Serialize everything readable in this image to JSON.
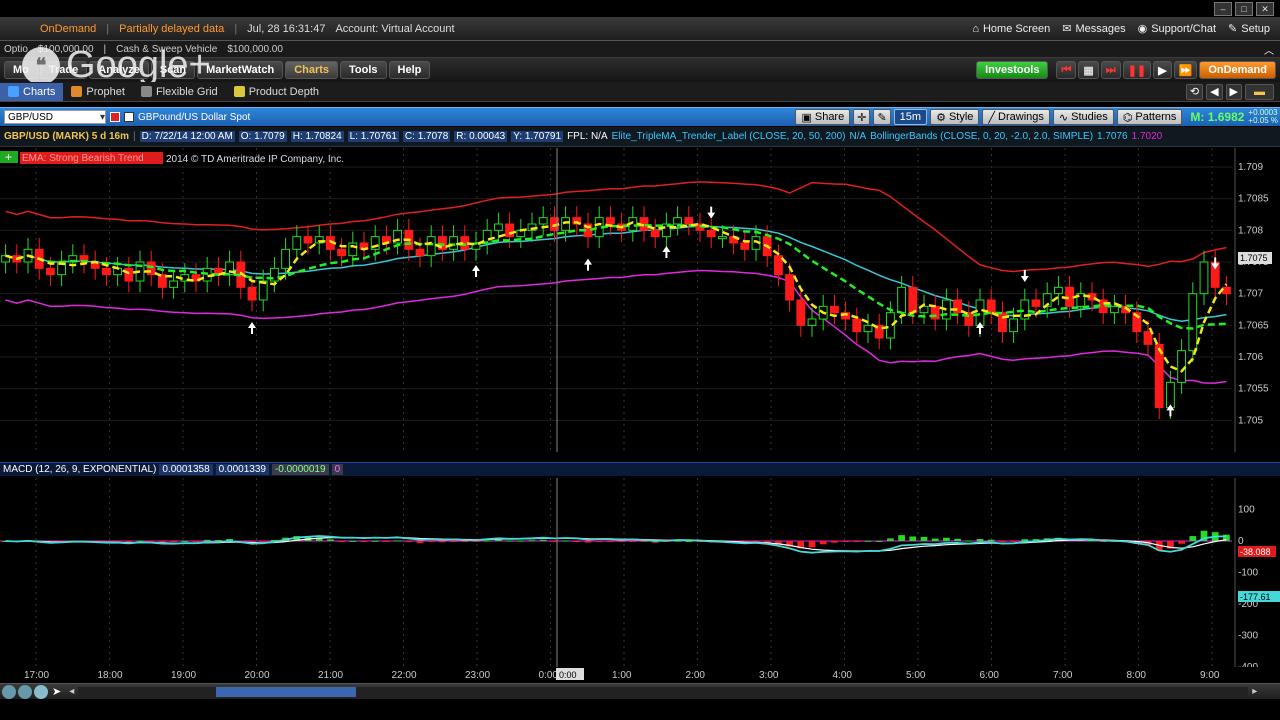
{
  "top": {
    "on_demand": "OnDemand",
    "data_status": "Partially delayed data",
    "timestamp": "Jul, 28  16:31:47",
    "account": "Account:  Virtual Account",
    "home_screen": "Home Screen",
    "messages": "Messages",
    "support": "Support/Chat",
    "setup": "Setup"
  },
  "account_bar": {
    "option": "Optio",
    "option_value": "$100,000.00",
    "cash_label": "Cash & Sweep Vehicle",
    "cash_value": "$100,000.00"
  },
  "watermark": "Google+",
  "nav": {
    "tabs": [
      "Mo",
      "Trade",
      "Analyze",
      "Scan",
      "MarketWatch",
      "Charts",
      "Tools",
      "Help"
    ],
    "active": "Charts",
    "investools": "Investools",
    "ondemand": "OnDemand"
  },
  "sub_nav": {
    "tabs": [
      "Charts",
      "Prophet",
      "Flexible Grid",
      "Product Depth"
    ]
  },
  "chart_toolbar": {
    "symbol": "GBP/USD",
    "description": "GBPound/US Dollar Spot",
    "share": "Share",
    "interval": "15m",
    "style": "Style",
    "drawings": "Drawings",
    "studies": "Studies",
    "patterns": "Patterns",
    "mark_value": "M: 1.6982",
    "change": "+0.0003",
    "change_pct": "+0.05 %"
  },
  "study_bar": {
    "symbol_info": "GBP/USD (MARK) 5 d 16m",
    "date": "D: 7/22/14 12:00 AM",
    "open": "O: 1.7079",
    "high": "H: 1.70824",
    "low": "L: 1.70761",
    "close": "C: 1.7078",
    "range": "R: 0.00043",
    "y": "Y: 1.70791",
    "fpl": "FPL: N/A",
    "study1": "Elite_TripleMA_Trender_Label (CLOSE, 20, 50, 200)",
    "study1_value": "N/A",
    "study2": "BollingerBands (CLOSE, 0, 20, -2.0, 2.0, SIMPLE)",
    "study2_value": "1.7076",
    "study2_value2": "1.7020"
  },
  "overlay": {
    "label": "EMA: Strong Bearish Trend",
    "copyright": "2014 © TD Ameritrade IP Company, Inc."
  },
  "macd": {
    "title": "MACD (12, 26, 9, EXPONENTIAL)",
    "value1": "0.0001358",
    "value2": "0.0001339",
    "value3": "-0.0000019",
    "value4": "0",
    "current_badge": "-38.088",
    "current_badge2": "-177.61"
  },
  "time_cursor": "0:00",
  "colors": {
    "bull": "#22dd22",
    "bear": "#ff1a1a",
    "upper_band": "#e21f1f",
    "lower_band": "#e028e0",
    "mid_band": "#38c8d8",
    "ma_green": "#22ee22",
    "ma_yellow": "#f2e81a",
    "macd_line": "#46d8d8",
    "signal_line": "#ffffff"
  },
  "chart_data": [
    {
      "type": "candlestick",
      "title": "GBP/USD (MARK) 5 d 16m",
      "ylim": [
        1.7045,
        1.7093
      ],
      "y_ticks": [
        "1.709",
        "1.7085",
        "1.708",
        "1.7075",
        "1.707",
        "1.7065",
        "1.706",
        "1.7055",
        "1.705"
      ],
      "x_ticks": [
        "17:00",
        "18:00",
        "19:00",
        "20:00",
        "21:00",
        "22:00",
        "23:00",
        "0:00",
        "1:00",
        "2:00",
        "3:00",
        "4:00",
        "5:00",
        "6:00",
        "7:00",
        "8:00",
        "9:00"
      ],
      "current_price_label": "1.7075",
      "series": [
        {
          "name": "close",
          "values": [
            1.7076,
            1.7075,
            1.7077,
            1.7074,
            1.7073,
            1.7075,
            1.7076,
            1.7075,
            1.7074,
            1.7073,
            1.7074,
            1.7072,
            1.7075,
            1.7073,
            1.7071,
            1.7072,
            1.7073,
            1.7072,
            1.7074,
            1.7073,
            1.7075,
            1.7071,
            1.7069,
            1.7072,
            1.7074,
            1.7077,
            1.7079,
            1.7078,
            1.7079,
            1.7077,
            1.7076,
            1.7078,
            1.7077,
            1.7079,
            1.7078,
            1.708,
            1.7077,
            1.7076,
            1.7079,
            1.7077,
            1.7079,
            1.7077,
            1.7078,
            1.708,
            1.7081,
            1.7079,
            1.708,
            1.7081,
            1.7082,
            1.708,
            1.7082,
            1.7081,
            1.7079,
            1.7082,
            1.7081,
            1.708,
            1.7082,
            1.708,
            1.7079,
            1.7081,
            1.7082,
            1.7081,
            1.708,
            1.7079,
            1.7079,
            1.7078,
            1.7077,
            1.7079,
            1.7076,
            1.7073,
            1.7069,
            1.7065,
            1.7066,
            1.7068,
            1.7067,
            1.7066,
            1.7064,
            1.7065,
            1.7063,
            1.7067,
            1.7071,
            1.7067,
            1.7068,
            1.7066,
            1.7069,
            1.7067,
            1.7065,
            1.7069,
            1.7067,
            1.7064,
            1.7066,
            1.7069,
            1.7068,
            1.707,
            1.7071,
            1.7068,
            1.707,
            1.7069,
            1.7067,
            1.7068,
            1.7067,
            1.7064,
            1.7062,
            1.7052,
            1.7056,
            1.7061,
            1.707,
            1.7075,
            1.7071,
            1.707
          ]
        }
      ]
    },
    {
      "type": "bar",
      "title": "MACD (12, 26, 9, EXPONENTIAL)",
      "ylim": [
        -400,
        200
      ],
      "y_ticks": [
        "100",
        "0",
        "-100",
        "-200",
        "-300",
        "-400"
      ]
    }
  ]
}
